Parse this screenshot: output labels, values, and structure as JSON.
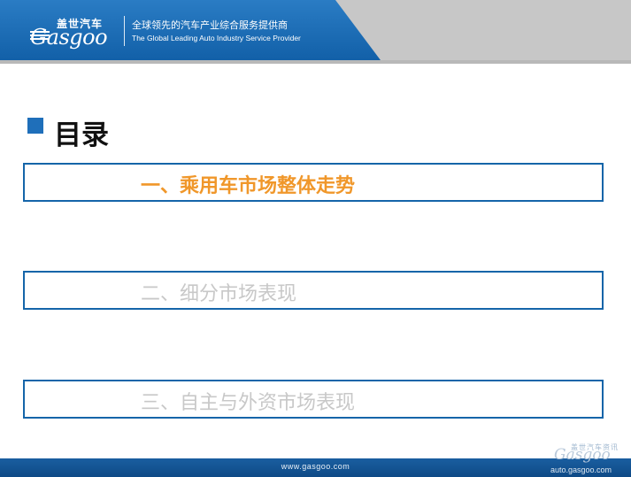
{
  "header": {
    "logo_cn": "盖世汽车",
    "logo_en": "Gasgoo",
    "tagline_cn": "全球领先的汽车产业综合服务提供商",
    "tagline_en": "The Global Leading Auto Industry Service Provider"
  },
  "title": "目录",
  "agenda": [
    {
      "label": "一、乘用车市场整体走势",
      "active": true
    },
    {
      "label": "二、细分市场表现",
      "active": false
    },
    {
      "label": "三、自主与外资市场表现",
      "active": false
    }
  ],
  "footer": {
    "url": "www.gasgoo.com"
  },
  "watermark": {
    "cn": "盖世汽车资讯",
    "en": "Gasgoo",
    "url": "auto.gasgoo.com"
  },
  "colors": {
    "header_blue": "#1f6fba",
    "box_border": "#1565a9",
    "active_text": "#f0972a",
    "inactive_text": "#c8c8c8"
  }
}
